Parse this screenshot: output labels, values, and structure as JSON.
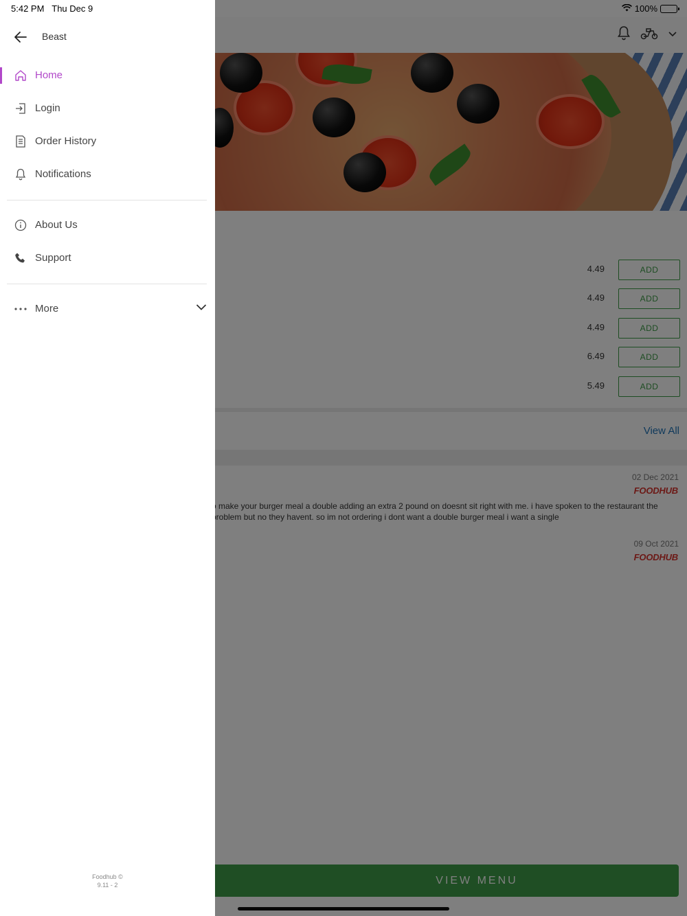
{
  "status_bar": {
    "time": "5:42 PM",
    "date": "Thu Dec 9",
    "battery": "100%"
  },
  "app": {
    "menu_items": [
      {
        "price": "4.49",
        "button": "ADD"
      },
      {
        "price": "4.49",
        "button": "ADD"
      },
      {
        "price": "4.49",
        "button": "ADD"
      },
      {
        "price": "6.49",
        "button": "ADD"
      },
      {
        "price": "5.49",
        "button": "ADD"
      }
    ],
    "reviews_link": "View All",
    "reviews": [
      {
        "date": "02 Dec 2021",
        "source": "FOODHUB",
        "text": "o make your burger meal a double adding an extra 2 pound on doesnt sit right with me. i have spoken to the restaurant the problem but no they havent. so im not ordering i dont want a double burger meal i want a single"
      },
      {
        "date": "09 Oct 2021",
        "source": "FOODHUB",
        "text": ""
      }
    ],
    "view_menu": "VIEW MENU"
  },
  "drawer": {
    "title": "Beast",
    "items_primary": [
      {
        "label": "Home",
        "icon": "home-icon",
        "active": true
      },
      {
        "label": "Login",
        "icon": "login-icon"
      },
      {
        "label": "Order History",
        "icon": "document-icon"
      },
      {
        "label": "Notifications",
        "icon": "bell-icon"
      }
    ],
    "items_secondary": [
      {
        "label": "About Us",
        "icon": "info-icon"
      },
      {
        "label": "Support",
        "icon": "phone-icon"
      }
    ],
    "more_label": "More",
    "footer_line1": "Foodhub ©",
    "footer_line2": "9.11 - 2"
  },
  "colors": {
    "accent": "#b148c9",
    "add_green": "#3a9a44",
    "view_menu_green": "#3e9c48",
    "link_blue": "#1f73b7",
    "brand_red": "#d8322d"
  }
}
